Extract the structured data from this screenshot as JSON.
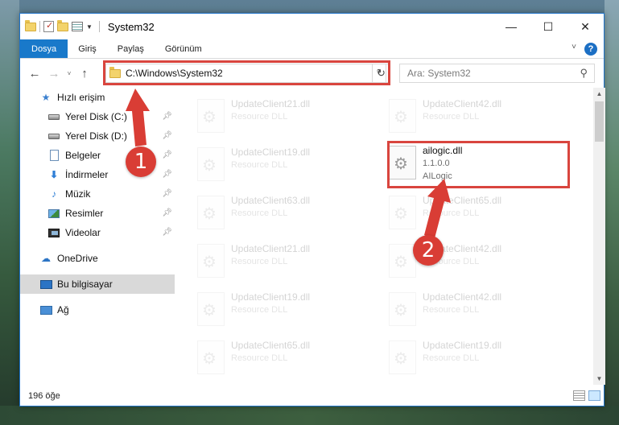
{
  "window": {
    "title": "System32"
  },
  "titlebar": {
    "minimize_glyph": "—",
    "maximize_glyph": "☐",
    "close_glyph": "✕"
  },
  "ribbon": {
    "tabs": [
      "Dosya",
      "Giriş",
      "Paylaş",
      "Görünüm"
    ],
    "help": "?"
  },
  "nav": {
    "back": "←",
    "forward": "→",
    "recent": "˅",
    "up": "↑",
    "address": "C:\\Windows\\System32",
    "refresh": "↻",
    "search_placeholder": "Ara: System32"
  },
  "sidebar": {
    "items": [
      {
        "label": "Hızlı erişim",
        "icon": "star-icon",
        "pinned": false
      },
      {
        "label": "Yerel Disk (C:)",
        "icon": "drive-icon",
        "pinned": true
      },
      {
        "label": "Yerel Disk (D:)",
        "icon": "drive-icon",
        "pinned": true
      },
      {
        "label": "Belgeler",
        "icon": "documents-icon",
        "pinned": true
      },
      {
        "label": "İndirmeler",
        "icon": "downloads-icon",
        "pinned": true
      },
      {
        "label": "Müzik",
        "icon": "music-icon",
        "pinned": true
      },
      {
        "label": "Resimler",
        "icon": "pictures-icon",
        "pinned": true
      },
      {
        "label": "Videolar",
        "icon": "videos-icon",
        "pinned": true
      },
      {
        "label": "OneDrive",
        "icon": "onedrive-icon",
        "pinned": false
      },
      {
        "label": "Bu bilgisayar",
        "icon": "this-pc-icon",
        "pinned": false
      },
      {
        "label": "Ağ",
        "icon": "network-icon",
        "pinned": false
      }
    ]
  },
  "files": [
    {
      "name": "UpdateClient21.dll",
      "desc": "Resource DLL",
      "faded": true
    },
    {
      "name": "UpdateClient42.dll",
      "desc": "Resource DLL",
      "faded": true
    },
    {
      "name": "UpdateClient19.dll",
      "desc": "Resource DLL",
      "faded": true
    },
    {
      "name": "ailogic.dll",
      "version": "1.1.0.0",
      "desc": "AILogic",
      "faded": false
    },
    {
      "name": "UpdateClient63.dll",
      "desc": "Resource DLL",
      "faded": true
    },
    {
      "name": "UpdateClient65.dll",
      "desc": "Resource DLL",
      "faded": true
    },
    {
      "name": "UpdateClient21.dll",
      "desc": "Resource DLL",
      "faded": true
    },
    {
      "name": "UpdateClient42.dll",
      "desc": "Resource DLL",
      "faded": true
    },
    {
      "name": "UpdateClient19.dll",
      "desc": "Resource DLL",
      "faded": true
    },
    {
      "name": "UpdateClient42.dll",
      "desc": "Resource DLL",
      "faded": true
    },
    {
      "name": "UpdateClient65.dll",
      "desc": "Resource DLL",
      "faded": true
    },
    {
      "name": "UpdateClient19.dll",
      "desc": "Resource DLL",
      "faded": true
    }
  ],
  "status": {
    "count": "196 öğe"
  },
  "markers": {
    "one": "1",
    "two": "2"
  },
  "colors": {
    "accent": "#1979ca",
    "highlight": "#d9453e",
    "selection": "#cce8ff"
  }
}
